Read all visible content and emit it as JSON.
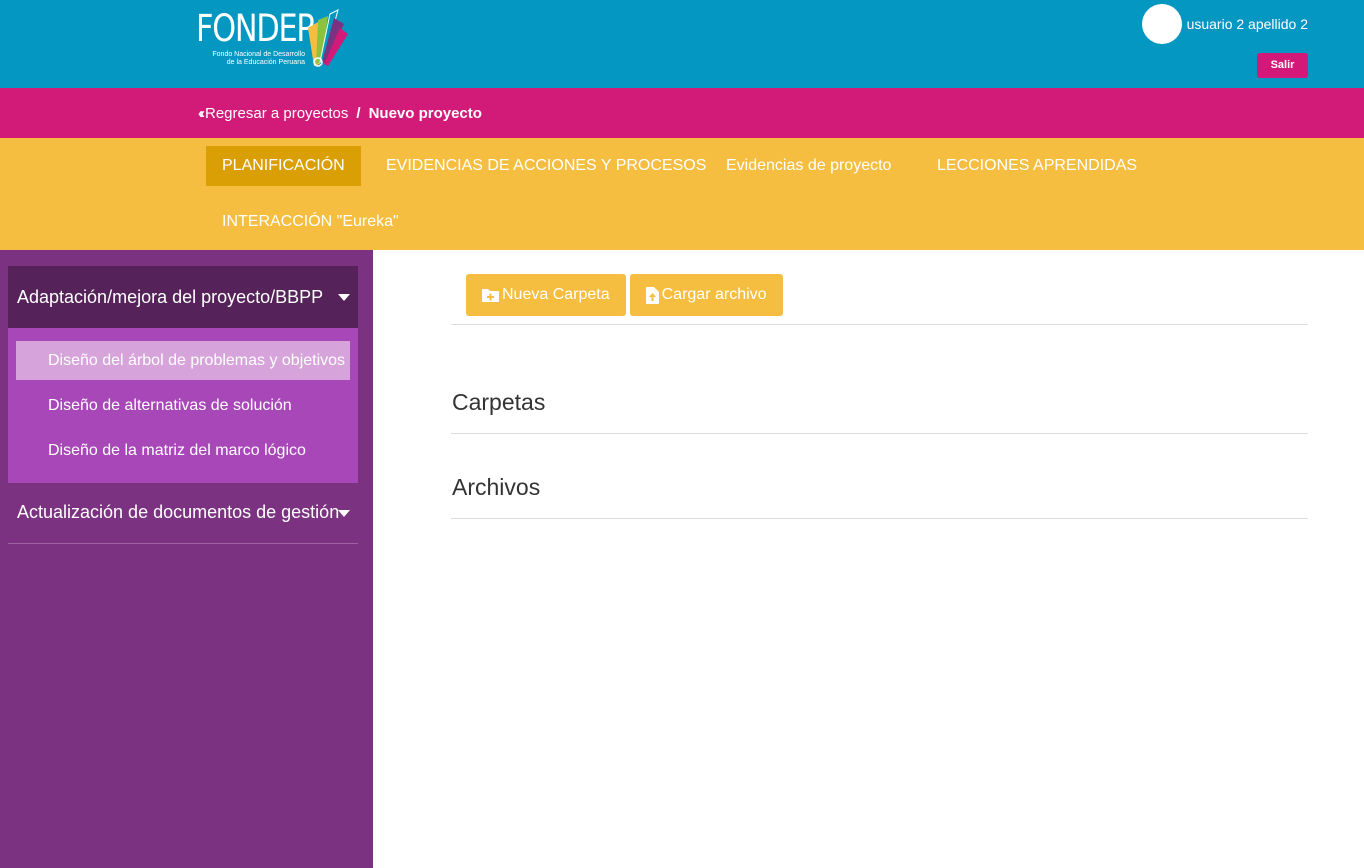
{
  "header": {
    "logo_text": "FONDEP",
    "logo_subtitle_line1": "Fondo Nacional de Desarrollo",
    "logo_subtitle_line2": "de la Educación Peruana",
    "user_name": "usuario 2 apellido 2",
    "logout_label": "Salir",
    "logout_color": "#d4187a",
    "brand_color": "#0497c2"
  },
  "breadcrumb": {
    "back_icon": "double-chevron-left-icon",
    "back_label": "Regresar a proyectos",
    "separator": "/",
    "current": "Nuevo proyecto",
    "bar_color": "#d21a78"
  },
  "tabs": [
    {
      "label": "PLANIFICACIÓN",
      "active": true
    },
    {
      "label": "EVIDENCIAS DE ACCIONES Y PROCESOS",
      "active": false
    },
    {
      "label": "Evidencias de proyecto",
      "active": false
    },
    {
      "label": "LECCIONES APRENDIDAS",
      "active": false
    },
    {
      "label": "INTERACCIÓN \"Eureka\"",
      "active": false
    }
  ],
  "sidebar": {
    "groups": [
      {
        "label": "Adaptación/mejora del proyecto/BBPP",
        "expanded": true,
        "items": [
          {
            "label": "Diseño del árbol de problemas y objetivos",
            "active": true
          },
          {
            "label": "Diseño de alternativas de solución",
            "active": false
          },
          {
            "label": "Diseño de la matriz del marco lógico",
            "active": false
          }
        ]
      },
      {
        "label": "Actualización de documentos de gestión",
        "expanded": false,
        "items": []
      }
    ]
  },
  "toolbar": {
    "new_folder_label": "Nueva Carpeta",
    "new_folder_icon": "folder-plus-icon",
    "upload_label": "Cargar archivo",
    "upload_icon": "file-upload-icon",
    "button_color": "#f6be41"
  },
  "main": {
    "folders_title": "Carpetas",
    "files_title": "Archivos"
  }
}
